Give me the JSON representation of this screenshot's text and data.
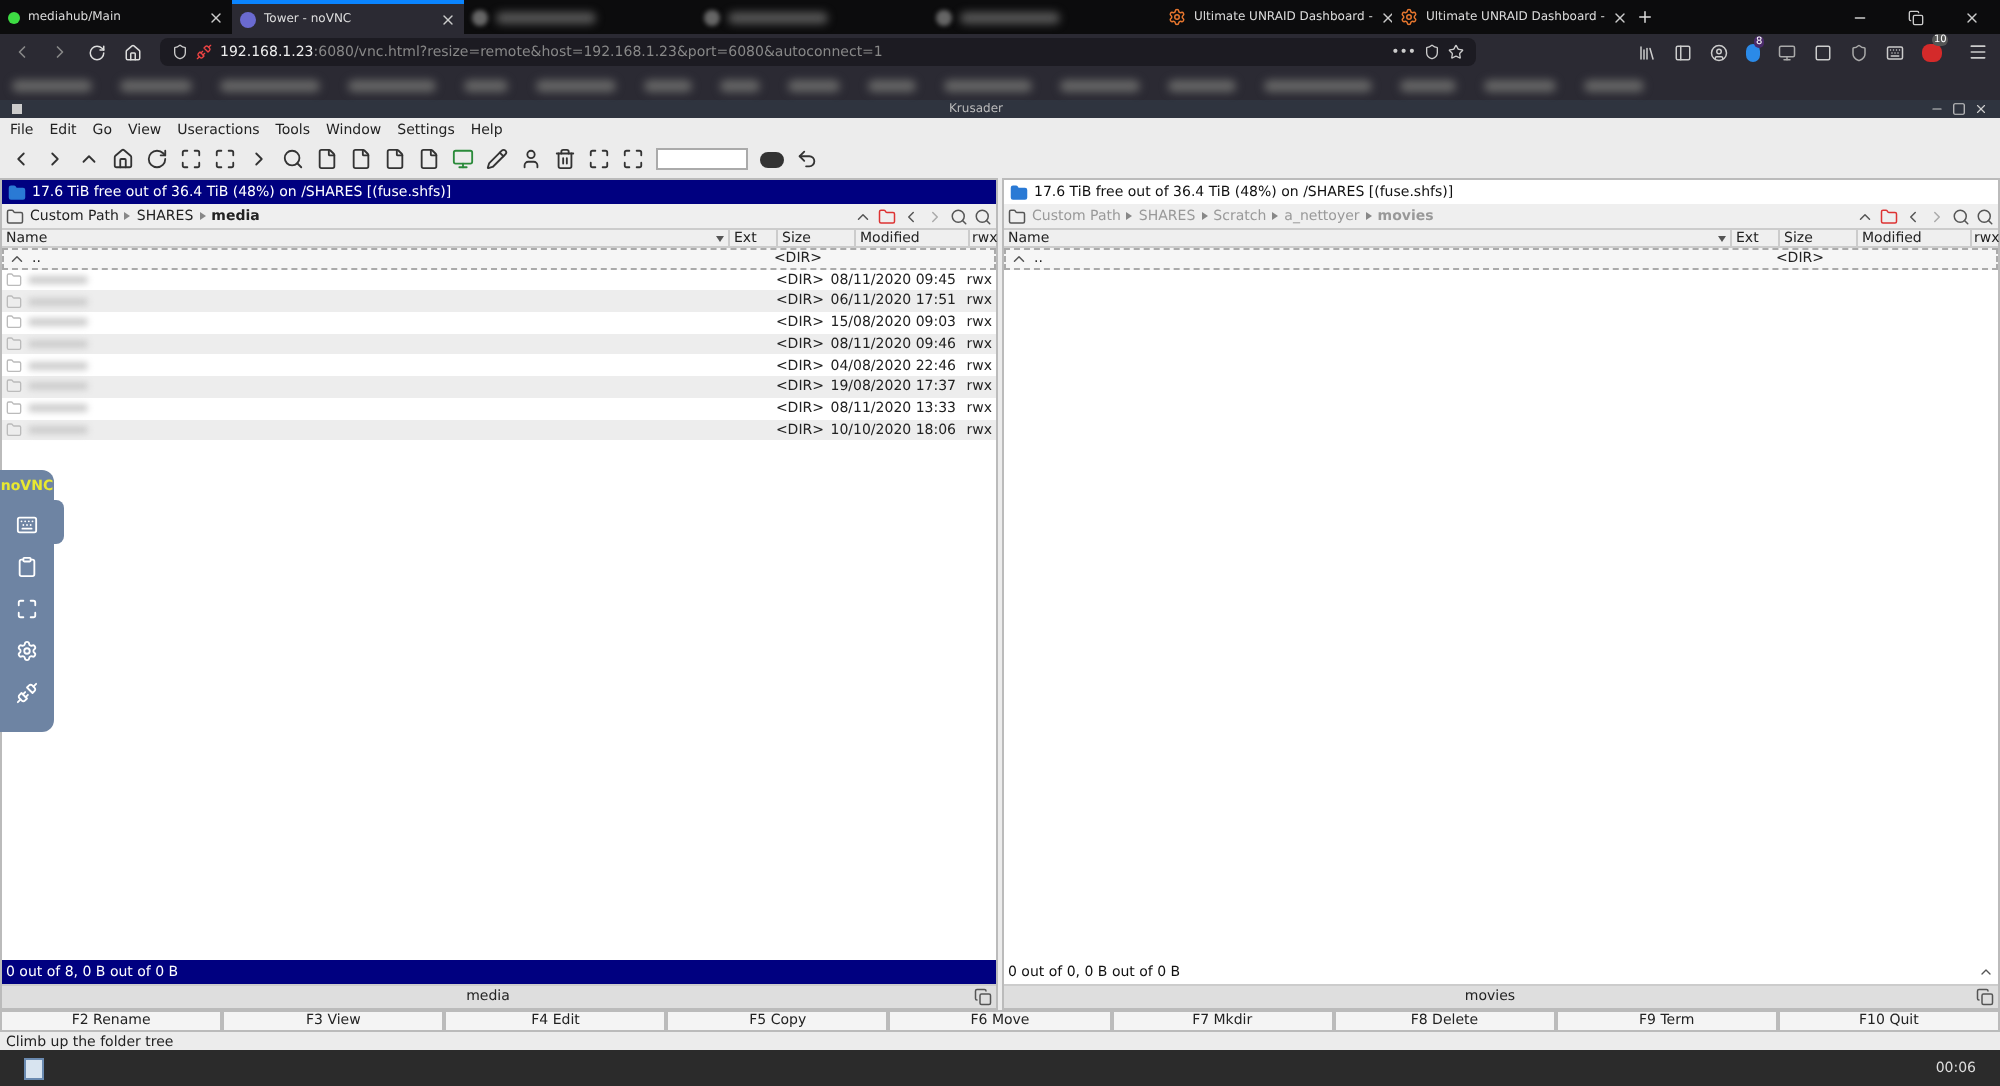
{
  "browser": {
    "tabs": [
      {
        "title": "mediahub/Main",
        "selected": false,
        "kind": "dot"
      },
      {
        "title": "Tower - noVNC",
        "selected": true,
        "kind": "vnc"
      },
      {
        "selected": false,
        "kind": "blurred"
      },
      {
        "selected": false,
        "kind": "blurred"
      },
      {
        "selected": false,
        "kind": "blurred"
      },
      {
        "title": "Ultimate UNRAID Dashboard -",
        "selected": false,
        "kind": "gear"
      },
      {
        "title": "Ultimate UNRAID Dashboard -",
        "selected": false,
        "kind": "gear"
      }
    ],
    "url": {
      "host": "192.168.1.23",
      "rest": ":6080/vnc.html?resize=remote&host=192.168.1.23&port=6080&autoconnect=1"
    },
    "page_actions": "•••",
    "badges": [
      "8",
      "10"
    ]
  },
  "window": {
    "title": "Krusader"
  },
  "menu": [
    "File",
    "Edit",
    "Go",
    "View",
    "Useractions",
    "Tools",
    "Window",
    "Settings",
    "Help"
  ],
  "panels": [
    {
      "active": true,
      "free_space": "17.6 TiB free out of 36.4 TiB (48%) on /SHARES [(fuse.shfs)]",
      "path": [
        "Custom Path",
        "SHARES",
        "media"
      ],
      "columns": [
        "Name",
        "Ext",
        "Size",
        "Modified",
        "rwx"
      ],
      "rows": [
        {
          "name": "..",
          "size": "<DIR>",
          "modified": "",
          "rwx": "",
          "kind": "up"
        },
        {
          "size": "<DIR>",
          "modified": "08/11/2020 09:45",
          "rwx": "rwx",
          "kind": "folder"
        },
        {
          "size": "<DIR>",
          "modified": "06/11/2020 17:51",
          "rwx": "rwx",
          "kind": "folder"
        },
        {
          "size": "<DIR>",
          "modified": "15/08/2020 09:03",
          "rwx": "rwx",
          "kind": "folder"
        },
        {
          "size": "<DIR>",
          "modified": "08/11/2020 09:46",
          "rwx": "rwx",
          "kind": "folder"
        },
        {
          "size": "<DIR>",
          "modified": "04/08/2020 22:46",
          "rwx": "rwx",
          "kind": "folder"
        },
        {
          "size": "<DIR>",
          "modified": "19/08/2020 17:37",
          "rwx": "rwx",
          "kind": "folder"
        },
        {
          "size": "<DIR>",
          "modified": "08/11/2020 13:33",
          "rwx": "rwx",
          "kind": "folder"
        },
        {
          "size": "<DIR>",
          "modified": "10/10/2020 18:06",
          "rwx": "rwx",
          "kind": "folder"
        }
      ],
      "status": "0 out of 8, 0 B out of 0 B",
      "label": "media"
    },
    {
      "active": false,
      "free_space": "17.6 TiB free out of 36.4 TiB (48%) on /SHARES [(fuse.shfs)]",
      "path": [
        "Custom Path",
        "SHARES",
        "Scratch",
        "a_nettoyer",
        "movies"
      ],
      "columns": [
        "Name",
        "Ext",
        "Size",
        "Modified",
        "rwx"
      ],
      "rows": [
        {
          "name": "..",
          "size": "<DIR>",
          "modified": "",
          "rwx": "",
          "kind": "up"
        }
      ],
      "status": "0 out of 0, 0 B out of 0 B",
      "label": "movies"
    }
  ],
  "function_keys": [
    "F2 Rename",
    "F3 View",
    "F4 Edit",
    "F5 Copy",
    "F6 Move",
    "F7 Mkdir",
    "F8 Delete",
    "F9 Term",
    "F10 Quit"
  ],
  "status_line": "Climb up the folder tree",
  "vnc_logo": "noVNC",
  "clock": "00:06"
}
